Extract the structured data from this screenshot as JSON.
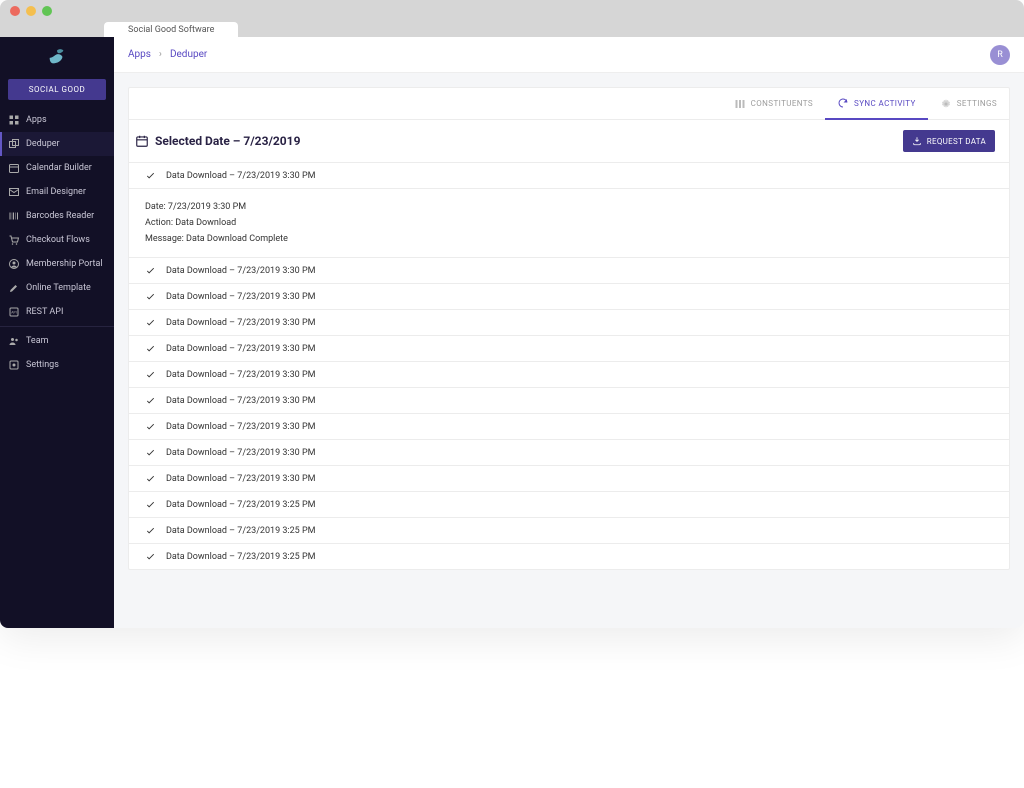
{
  "browser": {
    "tab_title": "Social Good Software",
    "traffic": {
      "red": "#ec6a5e",
      "yellow": "#f4bf4f",
      "green": "#61c554"
    }
  },
  "sidebar": {
    "brand_button": "SOCIAL GOOD",
    "items": [
      {
        "icon": "grid-icon",
        "label": "Apps"
      },
      {
        "icon": "dedupe-icon",
        "label": "Deduper"
      },
      {
        "icon": "calendar-icon",
        "label": "Calendar Builder"
      },
      {
        "icon": "mail-icon",
        "label": "Email Designer"
      },
      {
        "icon": "barcode-icon",
        "label": "Barcodes Reader"
      },
      {
        "icon": "cart-icon",
        "label": "Checkout Flows"
      },
      {
        "icon": "person-circle-icon",
        "label": "Membership Portal"
      },
      {
        "icon": "brush-icon",
        "label": "Online Template"
      },
      {
        "icon": "api-icon",
        "label": "REST API"
      }
    ],
    "footer_items": [
      {
        "icon": "team-icon",
        "label": "Team"
      },
      {
        "icon": "gear-box-icon",
        "label": "Settings"
      }
    ],
    "active_index": 1
  },
  "breadcrumb": {
    "items": [
      "Apps",
      "Deduper"
    ]
  },
  "avatar_initial": "R",
  "tabs": {
    "constituents": "CONSTITUENTS",
    "sync_activity": "SYNC ACTIVITY",
    "settings": "SETTINGS",
    "active": "sync_activity"
  },
  "page": {
    "title": "Selected Date – 7/23/2019",
    "request_button": "REQUEST DATA"
  },
  "log": {
    "expanded": {
      "date_label": "Date:",
      "date_value": "7/23/2019 3:30 PM",
      "action_label": "Action:",
      "action_value": "Data Download",
      "message_label": "Message:",
      "message_value": "Data Download Complete"
    },
    "rows": [
      "Data Download – 7/23/2019 3:30 PM",
      "Data Download – 7/23/2019 3:30 PM",
      "Data Download – 7/23/2019 3:30 PM",
      "Data Download – 7/23/2019 3:30 PM",
      "Data Download – 7/23/2019 3:30 PM",
      "Data Download – 7/23/2019 3:30 PM",
      "Data Download – 7/23/2019 3:30 PM",
      "Data Download – 7/23/2019 3:30 PM",
      "Data Download – 7/23/2019 3:30 PM",
      "Data Download – 7/23/2019 3:30 PM",
      "Data Download – 7/23/2019 3:25 PM",
      "Data Download – 7/23/2019 3:25 PM",
      "Data Download – 7/23/2019 3:25 PM"
    ]
  }
}
